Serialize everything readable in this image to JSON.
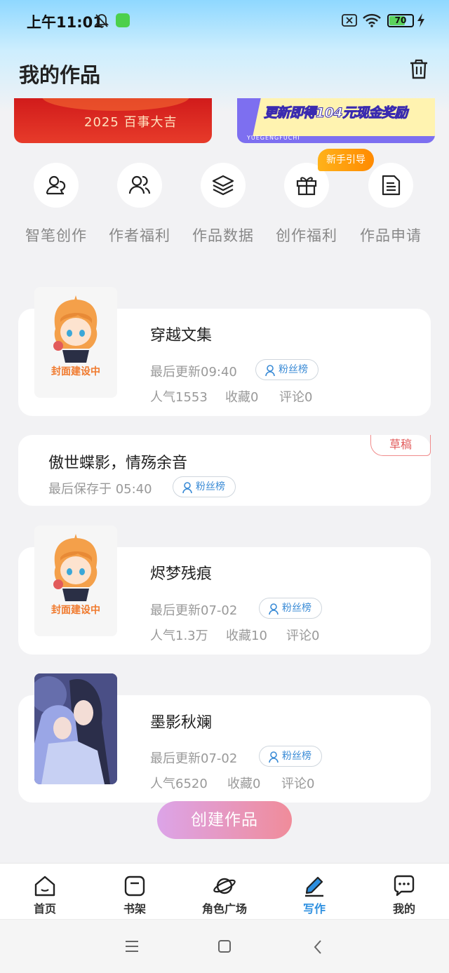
{
  "status_bar": {
    "time": "上午11:01",
    "battery": "70",
    "battery_percent": 70,
    "icons": [
      "bell-muted-icon",
      "app-notification-icon",
      "sim-icon",
      "wifi-icon",
      "battery-icon",
      "charging-icon"
    ]
  },
  "header": {
    "title": "我的作品"
  },
  "banners": {
    "left_text": "2025 百事大吉",
    "right_text": "更新即得104元现金奖励",
    "right_sub": "YUEGENGFUCHI"
  },
  "guide_tag": "新手引导",
  "quick_actions": [
    {
      "label": "智笔创作",
      "icon": "user-pen-icon"
    },
    {
      "label": "作者福利",
      "icon": "users-icon"
    },
    {
      "label": "作品数据",
      "icon": "layers-icon"
    },
    {
      "label": "创作福利",
      "icon": "gift-icon"
    },
    {
      "label": "作品申请",
      "icon": "document-icon"
    }
  ],
  "works": [
    {
      "title": "穿越文集",
      "update": "最后更新09:40",
      "fans": "粉丝榜",
      "popularity": "人气1553",
      "favorites": "收藏0",
      "comments": "评论0",
      "cover_caption": "封面建设中"
    },
    {
      "title": "傲世蝶影，情殇余音",
      "saved": "最后保存于 05:40",
      "fans": "粉丝榜",
      "tag": "草稿"
    },
    {
      "title": "烬梦残痕",
      "update": "最后更新07-02",
      "fans": "粉丝榜",
      "popularity": "人气1.3万",
      "favorites": "收藏10",
      "comments": "评论0",
      "cover_caption": "封面建设中"
    },
    {
      "title": "墨影秋斓",
      "update": "最后更新07-02",
      "fans": "粉丝榜",
      "popularity": "人气6520",
      "favorites": "收藏0",
      "comments": "评论0"
    }
  ],
  "create_button": "创建作品",
  "tabs": [
    {
      "label": "首页",
      "icon": "home-icon"
    },
    {
      "label": "书架",
      "icon": "bookshelf-icon"
    },
    {
      "label": "角色广场",
      "icon": "planet-icon"
    },
    {
      "label": "写作",
      "icon": "pen-icon",
      "active": true
    },
    {
      "label": "我的",
      "icon": "chat-bubble-icon"
    }
  ],
  "colors": {
    "accent": "#2d8fe0",
    "draft": "#e25b5b",
    "cover_caption": "#f07a2e",
    "guide": "#ff9a0e"
  }
}
